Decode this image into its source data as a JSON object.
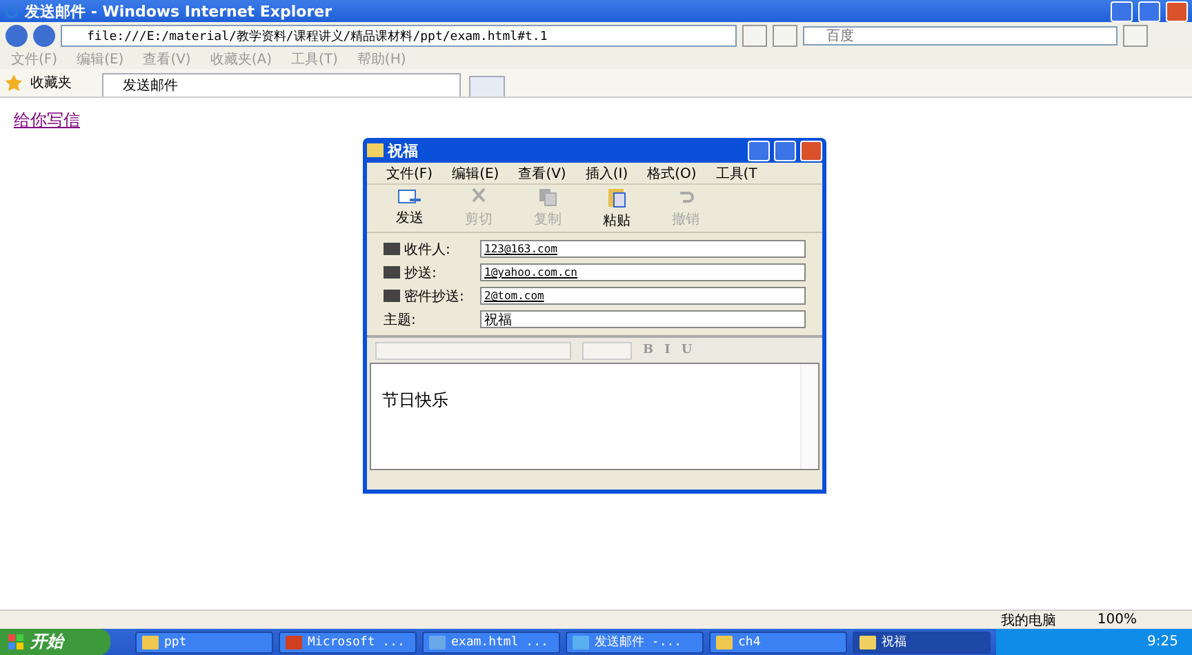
{
  "window": {
    "title": "发送邮件 - Windows Internet Explorer"
  },
  "address_bar": {
    "url": "file:///E:/material/教学资料/课程讲义/精品课材料/ppt/exam.html#t.1"
  },
  "search": {
    "placeholder": "百度"
  },
  "menu": [
    "文件(F)",
    "编辑(E)",
    "查看(V)",
    "收藏夹(A)",
    "工具(T)",
    "帮助(H)"
  ],
  "favorites": {
    "label": "收藏夹"
  },
  "tabs": [
    {
      "label": "发送邮件",
      "selected": true
    }
  ],
  "page": {
    "link": "给你写信"
  },
  "dialog": {
    "title": "祝福",
    "menu": [
      "文件(F)",
      "编辑(E)",
      "查看(V)",
      "插入(I)",
      "格式(O)",
      "工具(T"
    ],
    "toolbar": [
      {
        "label": "发送",
        "disabled": false,
        "kind": "send"
      },
      {
        "label": "剪切",
        "disabled": true,
        "kind": "cut"
      },
      {
        "label": "复制",
        "disabled": true,
        "kind": "copy"
      },
      {
        "label": "粘贴",
        "disabled": false,
        "kind": "paste"
      },
      {
        "label": "撤销",
        "disabled": true,
        "kind": "undo"
      }
    ],
    "fields": [
      {
        "label": "收件人:",
        "value": "123@163.com",
        "kind": "address"
      },
      {
        "label": "抄送:",
        "value": "1@yahoo.com.cn",
        "kind": "address"
      },
      {
        "label": "密件抄送:",
        "value": "2@tom.com",
        "kind": "address"
      },
      {
        "label": "主题:",
        "value": "祝福",
        "kind": "subject"
      }
    ],
    "format_buttons": [
      "B",
      "I",
      "U"
    ],
    "body": "节日快乐"
  },
  "status_bar": {
    "zone": "我的电脑",
    "zoom": "100%"
  },
  "taskbar": {
    "start": "开始",
    "clock": "9:25",
    "tasks": [
      {
        "label": "ppt",
        "kind": "folder",
        "selected": false
      },
      {
        "label": "Microsoft ...",
        "kind": "app",
        "selected": false
      },
      {
        "label": "exam.html ...",
        "kind": "doc",
        "selected": false
      },
      {
        "label": "发送邮件 -...",
        "kind": "browser",
        "selected": false
      },
      {
        "label": "ch4",
        "kind": "folder",
        "selected": false
      },
      {
        "label": "祝福",
        "kind": "mail",
        "selected": true
      }
    ]
  }
}
